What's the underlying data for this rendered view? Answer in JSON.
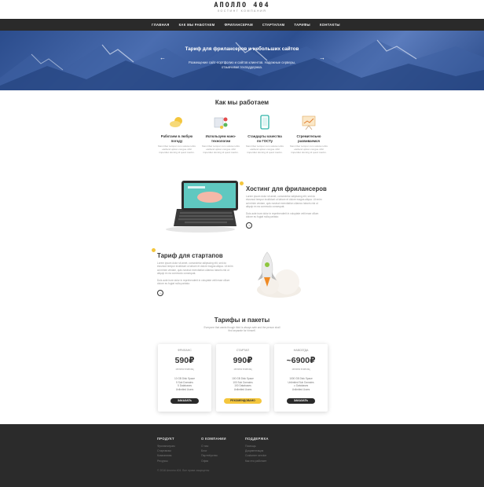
{
  "brand": {
    "name": "АПОЛЛО 404",
    "tagline": "ХОСТИНГ КОМПАНИЯ"
  },
  "nav": [
    "ГЛАВНАЯ",
    "КАК МЫ РАБОТАЕМ",
    "ФРИЛАНСЕРАМ",
    "СТАРТАПАМ",
    "ТАРИФЫ",
    "КОНТАКТЫ"
  ],
  "hero": {
    "title": "Тариф для фрилансеров и небольших сайтов",
    "subtitle": "Размещение сайт-портфолио и сайтов клиентов. Надежные серверы, отзывчивая техподдержка.",
    "prev": "←",
    "next": "→"
  },
  "how": {
    "title": "Как мы работаем",
    "items": [
      {
        "icon": "sun-cloud-icon",
        "title": "Работаем в любую погоду",
        "text": "Nam liber tempor cum soluta nobis eleifend option congue nihil imperdiet doming id quod mazim."
      },
      {
        "icon": "nano-tech-icon",
        "title": "Используем нано-технологии",
        "text": "Nam liber tempor cum soluta nobis eleifend option congue nihil imperdiet doming id quod mazim."
      },
      {
        "icon": "phone-standard-icon",
        "title": "Стандарты качества по ГОСТу",
        "text": "Nam liber tempor cum soluta nobis eleifend option congue nihil imperdiet doming id quod mazim."
      },
      {
        "icon": "growth-board-icon",
        "title": "Стремительно развиваемся",
        "text": "Nam liber tempor cum soluta nobis eleifend option congue nihil imperdiet doming id quod mazim."
      }
    ]
  },
  "freelancers": {
    "title": "Хостинг для фрилансеров",
    "p1": "Lorem ipsum dolor sit amet, consectetur adipiscing elit, sed do eiusmod tempor incididunt ut labore et dolore magna aliqua. Ut enim ad minim veniam, quis nostrud exercitation ullamco laboris nisi ut aliquip ex ea commodo consequat.",
    "p2": "Duis aute irure dolor in reprehenderit in voluptate velit esse cillum dolore eu fugiat nulla pariatur.",
    "btn": "→"
  },
  "startups": {
    "title": "Тариф для стартапов",
    "p1": "Lorem ipsum dolor sit amet, consectetur adipiscing elit, sed do eiusmod tempor incididunt ut labore et dolore magna aliqua. Ut enim ad minim veniam, quis nostrud exercitation ullamco laboris nisi ut aliquip ex ea commodo consequat.",
    "p2": "Duis aute irure dolor in reprehenderit in voluptate velit esse cillum dolore eu fugiat nulla pariatur.",
    "btn": "→"
  },
  "pricing": {
    "title": "Тарифы и пакеты",
    "desc": "Everyone that wants though third is always safe and the person shall find separate for himself.",
    "plans": [
      {
        "name": "ФРИЛАНС",
        "price": "590₽",
        "period": "оплата в месяц",
        "features": [
          "10 GB Disk Space",
          "5 Sub Domains",
          "5 Databases",
          "Unlimited Users"
        ],
        "cta": "ЗАКАЗАТЬ"
      },
      {
        "name": "СТАРТАП",
        "price": "990₽",
        "period": "оплата в месяц",
        "features": [
          "100 GB Disk Space",
          "100 Sub Domains",
          "100 Databases",
          "Unlimited Users"
        ],
        "cta": "РЕКОМЕНДОВАНО"
      },
      {
        "name": "НАВСЕГДА",
        "price": "~6900₽",
        "period": "оплата в месяц",
        "features": [
          "1000 GB Disk Space",
          "Unlimited Sub Domains",
          "∞ Databases",
          "Unlimited Users"
        ],
        "cta": "ЗАКАЗАТЬ"
      }
    ]
  },
  "footer": {
    "cols": [
      {
        "title": "ПРОДУКТ",
        "links": [
          "Фрилансерам",
          "Стартапам",
          "Компаниям",
          "Ресурсы"
        ]
      },
      {
        "title": "О КОМПАНИИ",
        "links": [
          "О нас",
          "Блог",
          "Партнёрство",
          "Офис"
        ]
      },
      {
        "title": "ПОДДЕРЖКА",
        "links": [
          "Помощь",
          "Документация",
          "Customer service",
          "Как это работает"
        ]
      }
    ],
    "copyright": "© 2016 Аполло 404. Все права защищены"
  },
  "colors": {
    "accent": "#f4c63d",
    "dark": "#2a2a2a",
    "hero": "#2d4f90"
  }
}
